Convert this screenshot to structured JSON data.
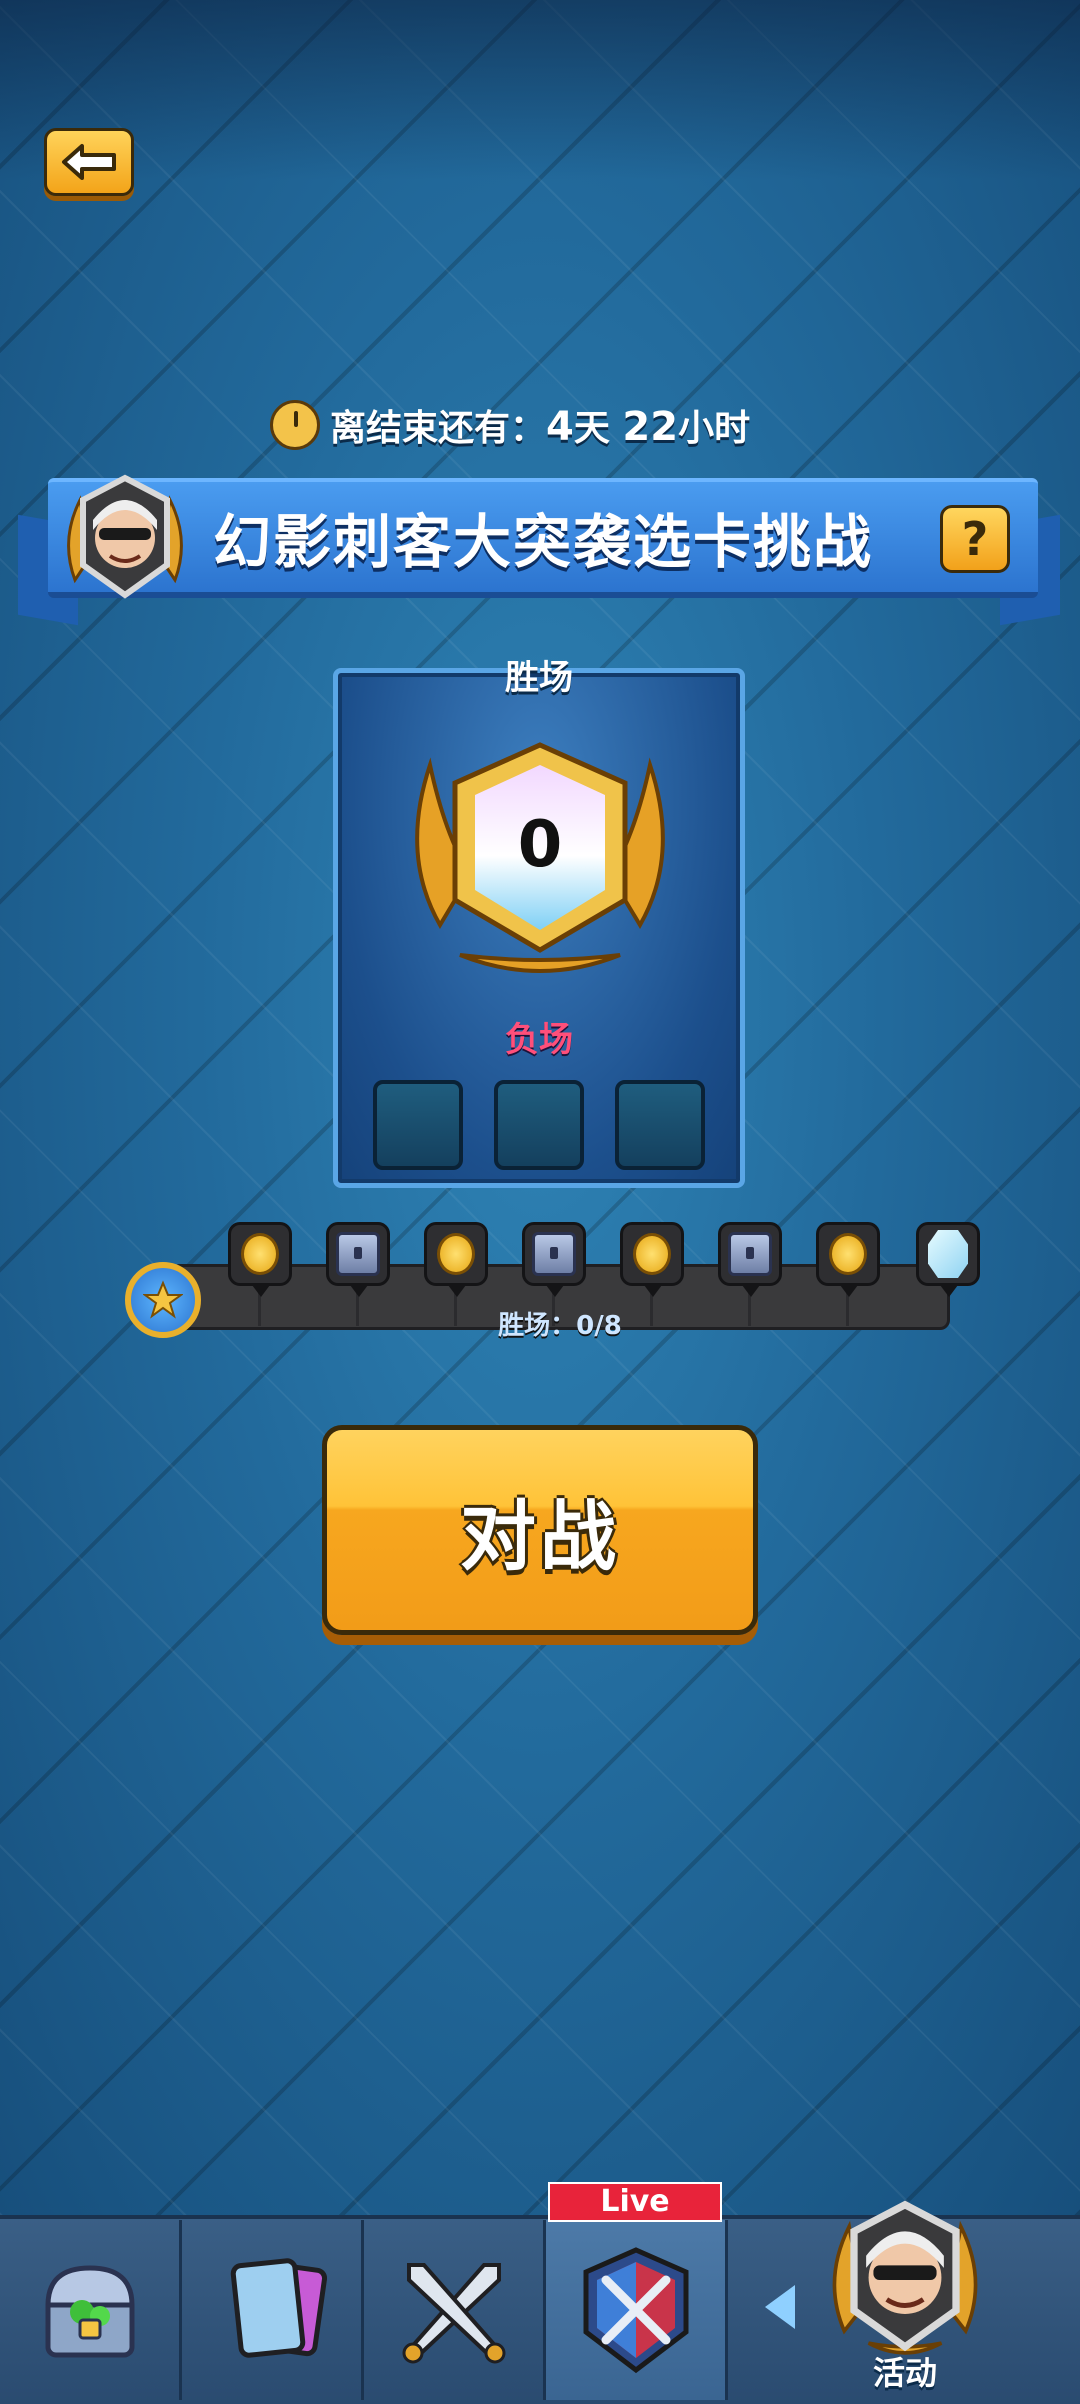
{
  "header": {
    "timer": {
      "prefix": "离结束还有：",
      "days": "4",
      "days_unit": "天",
      "hours": "22",
      "hours_unit": "小时"
    }
  },
  "challenge": {
    "title": "幻影刺客大突袭选卡挑战",
    "help_label": "?"
  },
  "panel": {
    "wins_label": "胜场",
    "wins_count": "0",
    "losses_label": "负场",
    "loss_slots": 3,
    "losses": 0
  },
  "progress": {
    "label": "胜场：0/8",
    "current": 0,
    "total": 8,
    "rewards": [
      "gold-coin-icon",
      "chest-icon",
      "gold-coin-icon",
      "chest-icon",
      "gold-coin-icon",
      "chest-icon",
      "gold-coin-icon",
      "crystal-icon"
    ]
  },
  "battle": {
    "label": "对战"
  },
  "nav": {
    "tabs": [
      {
        "name": "shop-tab",
        "icon": "treasure-chest-icon"
      },
      {
        "name": "cards-tab",
        "icon": "cards-icon"
      },
      {
        "name": "battle-tab",
        "icon": "crossed-swords-icon"
      },
      {
        "name": "clan-wars-tab",
        "icon": "shield-swords-icon",
        "active": true
      }
    ],
    "live_badge": "Live",
    "event_label": "活动"
  },
  "colors": {
    "accent_blue": "#2c74cf",
    "button_gold": "#f7a71f",
    "loss_pink": "#ff4f7a",
    "live_red": "#e8233a"
  }
}
